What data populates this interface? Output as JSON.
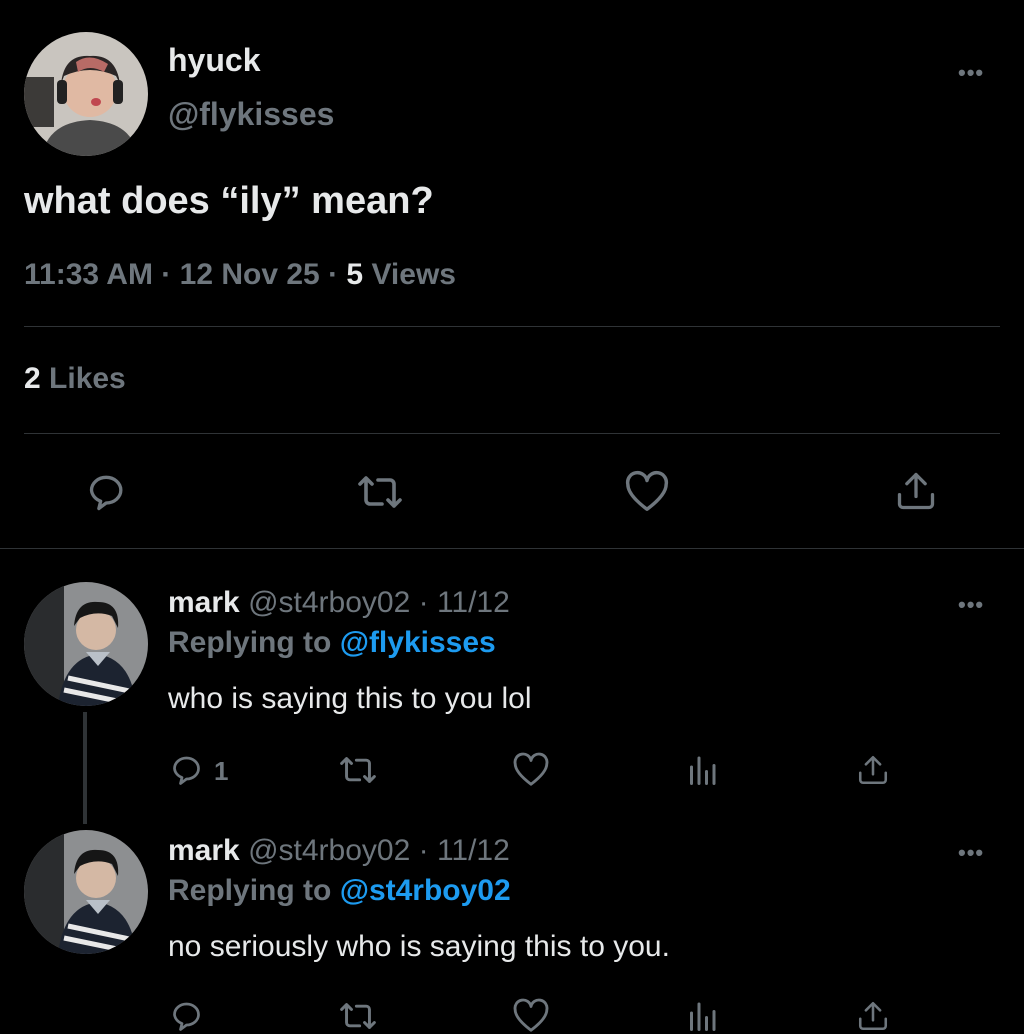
{
  "main_tweet": {
    "display_name": "hyuck",
    "handle": "@flykisses",
    "text": "what does “ily” mean?",
    "time": "11:33 AM",
    "sep1": "·",
    "date": "12 Nov 25",
    "sep2": "·",
    "views_count": "5",
    "views_label": "Views",
    "likes_count": "2",
    "likes_label": "Likes",
    "more": "•••"
  },
  "replies": [
    {
      "display_name": "mark",
      "handle": "@st4rboy02",
      "sep": "·",
      "date": "11/12",
      "replying_prefix": "Replying to",
      "replying_to": "@flykisses",
      "text": "who is saying this to you lol",
      "reply_count": "1",
      "more": "•••"
    },
    {
      "display_name": "mark",
      "handle": "@st4rboy02",
      "sep": "·",
      "date": "11/12",
      "replying_prefix": "Replying to",
      "replying_to": "@st4rboy02",
      "text": "no seriously who is saying this to you.",
      "reply_count": "",
      "more": "•••"
    }
  ],
  "colors": {
    "background": "#000000",
    "text": "#e7e9ea",
    "muted": "#6e767d",
    "link": "#1d9bf0",
    "divider": "#2f3336"
  },
  "icons": [
    "reply-icon",
    "retweet-icon",
    "like-icon",
    "share-icon",
    "views-icon",
    "more-icon"
  ]
}
